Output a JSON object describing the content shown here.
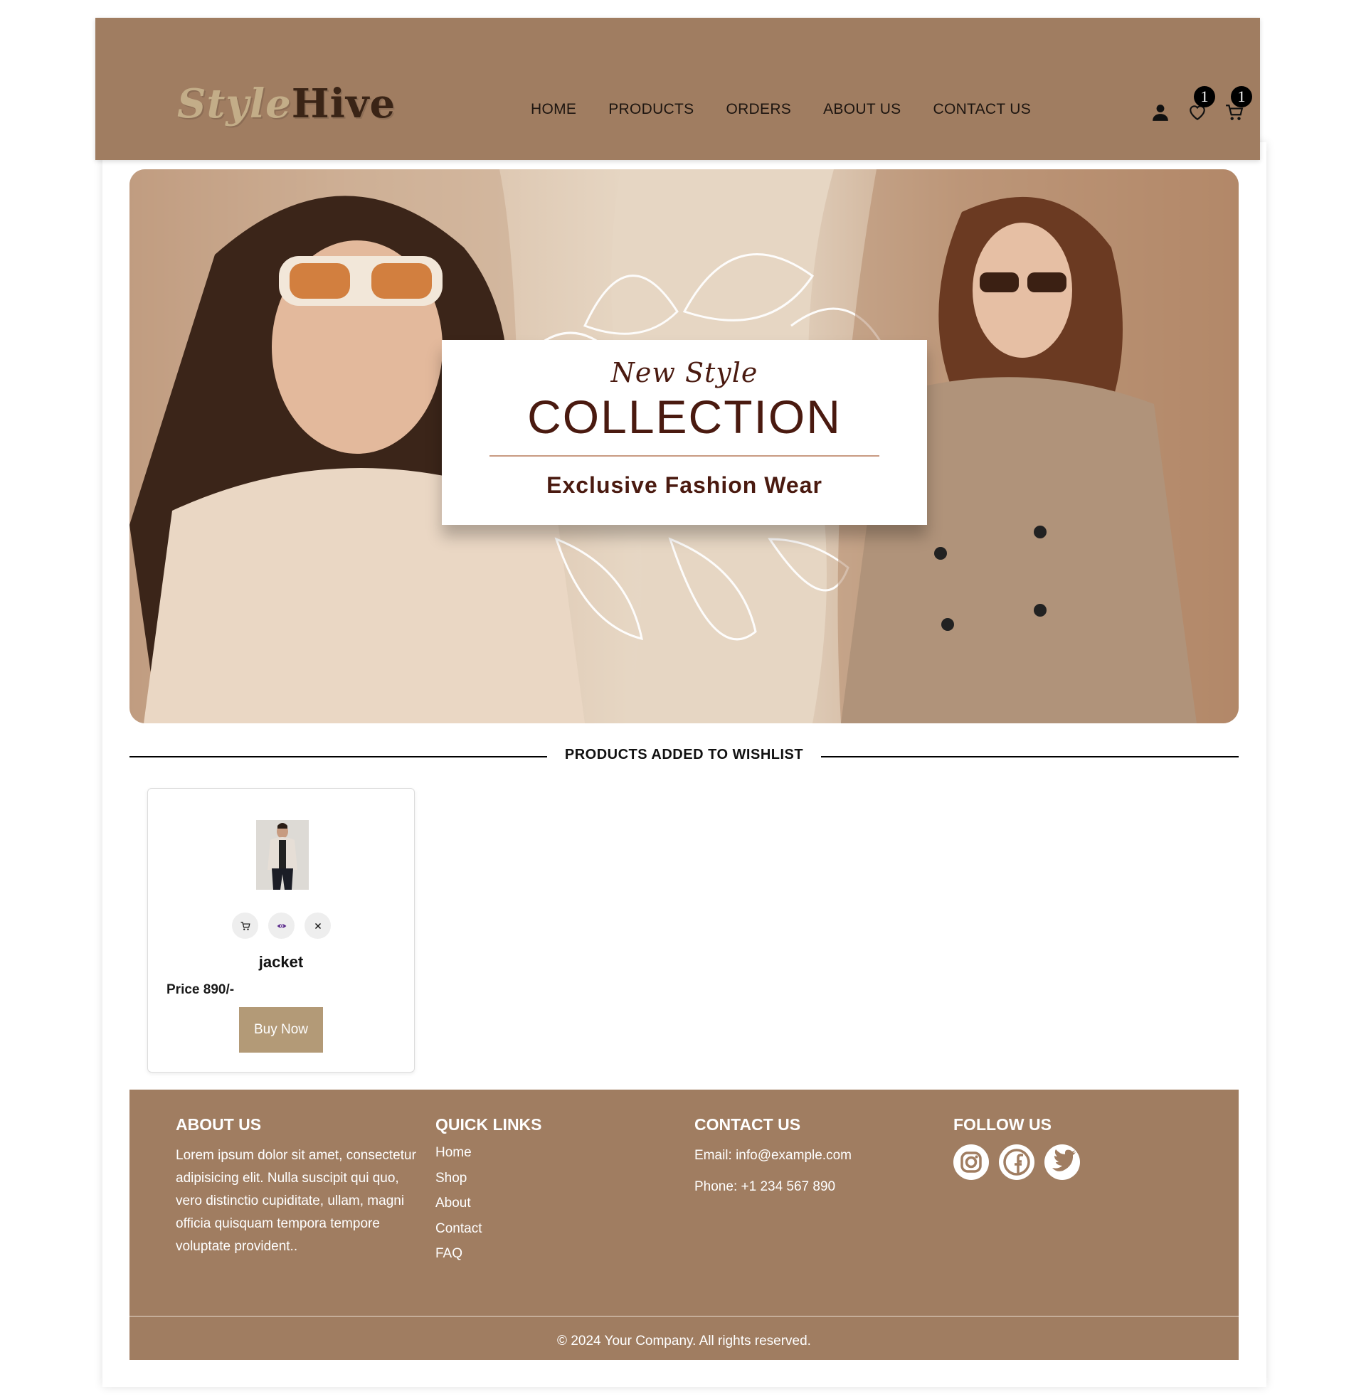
{
  "header": {
    "logo_part1": "Style",
    "logo_part2": "Hive",
    "nav": [
      "HOME",
      "PRODUCTS",
      "ORDERS",
      "ABOUT US",
      "CONTACT US"
    ],
    "icons": [
      "user-icon",
      "heart-icon",
      "cart-icon"
    ],
    "wishlist_count": "1",
    "cart_count": "1"
  },
  "hero": {
    "kicker": "New Style",
    "title": "COLLECTION",
    "subtitle": "Exclusive Fashion Wear"
  },
  "wishlist": {
    "section_title": "PRODUCTS ADDED TO WISHLIST",
    "items": [
      {
        "name": "jacket",
        "price": "Price 890/-",
        "buy_label": "Buy Now",
        "actions": [
          "cart-icon",
          "eye-icon",
          "close-icon"
        ]
      }
    ]
  },
  "footer": {
    "about": {
      "heading": "ABOUT US",
      "text": "Lorem ipsum dolor sit amet, consectetur adipisicing elit. Nulla suscipit qui quo, vero distinctio cupiditate, ullam, magni officia quisquam tempora tempore voluptate provident.."
    },
    "quick_links": {
      "heading": "QUICK LINKS",
      "links": [
        "Home",
        "Shop",
        "About",
        "Contact",
        "FAQ"
      ]
    },
    "contact": {
      "heading": "CONTACT US",
      "email": "Email: info@example.com",
      "phone": "Phone: +1 234 567 890"
    },
    "follow": {
      "heading": "FOLLOW US",
      "icons": [
        "instagram-icon",
        "facebook-icon",
        "twitter-icon"
      ]
    },
    "copyright": "© 2024 Your Company. All rights reserved."
  },
  "colors": {
    "brand_brown": "#a07d61",
    "button_tan": "#b39a77",
    "hero_text": "#4a1a10"
  }
}
